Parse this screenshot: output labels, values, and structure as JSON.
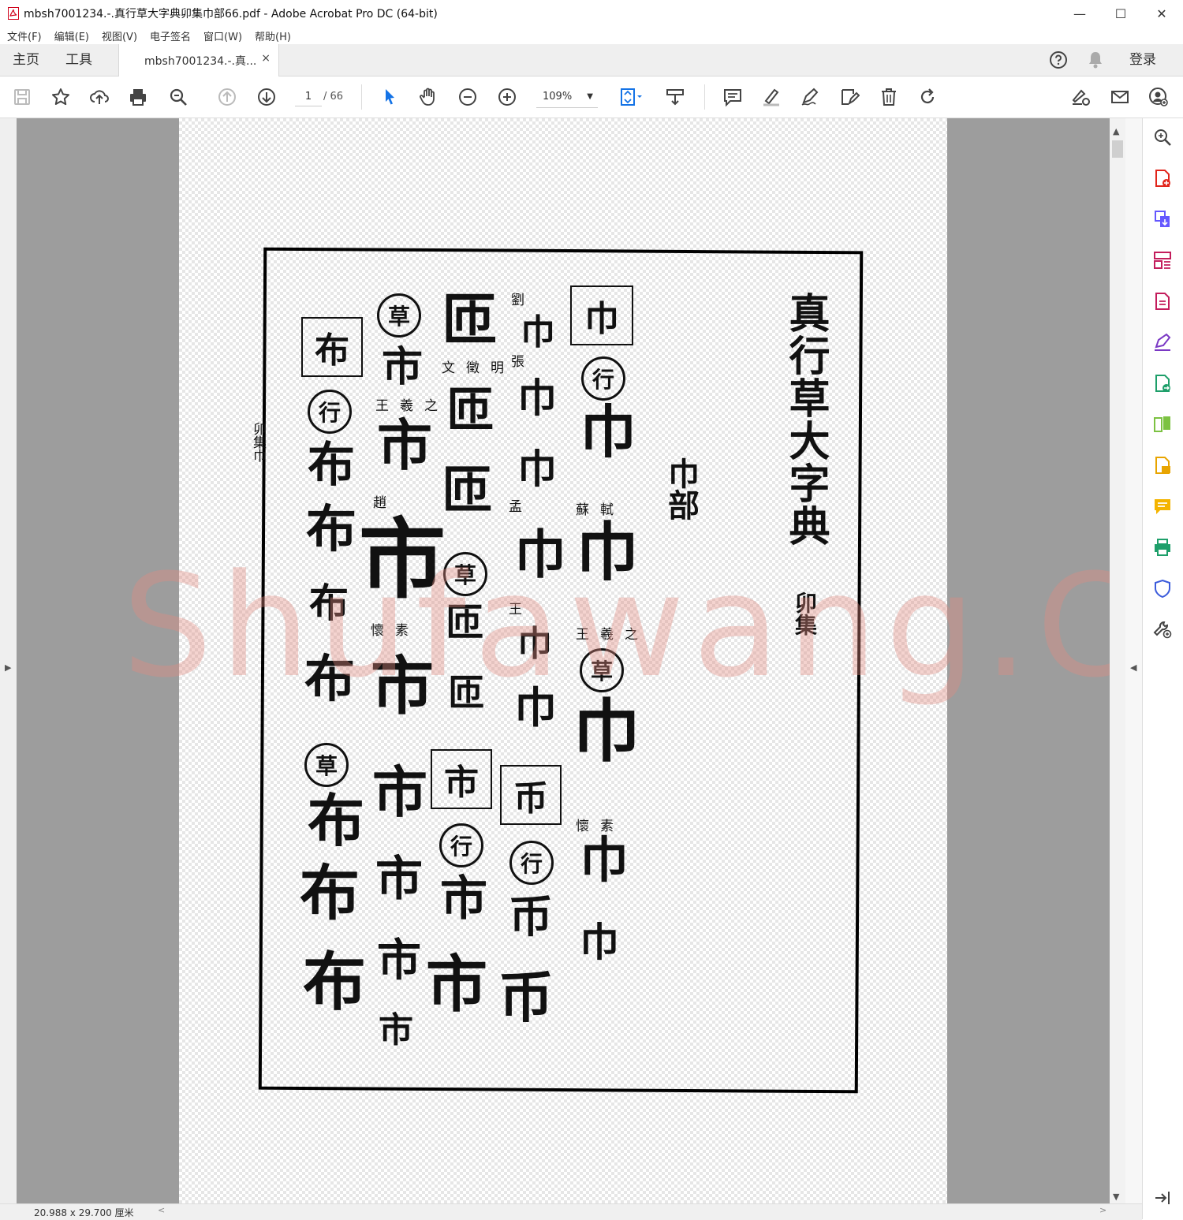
{
  "window": {
    "title": "mbsh7001234.-.真行草大字典卯集巾部66.pdf - Adobe Acrobat Pro DC (64-bit)",
    "minimize_label": "—",
    "maximize_label": "☐",
    "close_label": "✕"
  },
  "menu": {
    "items": [
      "文件(F)",
      "编辑(E)",
      "视图(V)",
      "电子签名",
      "窗口(W)",
      "帮助(H)"
    ]
  },
  "tabs": {
    "home": "主页",
    "tools": "工具",
    "document": "mbsh7001234.-.真...",
    "close": "×",
    "login": "登录"
  },
  "toolbar": {
    "page_current": "1",
    "page_total": "/ 66",
    "zoom": "109%"
  },
  "document": {
    "heading": "真行草大字典",
    "volume": "卯集",
    "radical": "巾部",
    "side_note": "卯集巾",
    "boxed_chars": [
      "巾",
      "币",
      "市",
      "布"
    ],
    "circle_marks": {
      "xing": "行",
      "cao": "草"
    },
    "chars": {
      "jin": "巾",
      "bi": "币",
      "shi": "市",
      "bu": "布",
      "za": "匝"
    },
    "sources": {
      "s1": "蘇軾",
      "s2": "王羲之",
      "s3": "懷素",
      "s4": "劉",
      "s5": "張",
      "s6": "孟",
      "s7": "王",
      "s8": "文徵明",
      "s9": "趙",
      "s10": "王羲之",
      "s11": "懷素"
    }
  },
  "watermark": "Shufawang.CN",
  "status": {
    "dimensions": "20.988 x 29.700 厘米"
  }
}
